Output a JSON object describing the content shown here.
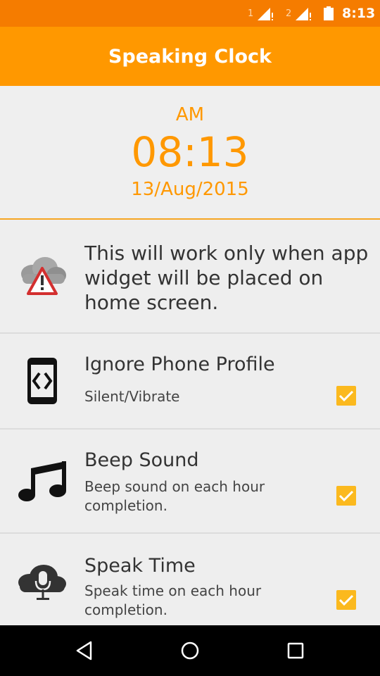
{
  "status_bar": {
    "sim1": "1",
    "sim2": "2",
    "time": "8:13"
  },
  "app_bar": {
    "title": "Speaking Clock"
  },
  "clock": {
    "ampm": "AM",
    "time": "08:13",
    "date": "13/Aug/2015"
  },
  "info": {
    "text": "This will work only when app widget will be placed on home screen.",
    "icon": "cloud-warning-icon"
  },
  "settings": [
    {
      "title": "Ignore Phone Profile",
      "subtitle": "Silent/Vibrate",
      "checked": true,
      "icon": "phone-code-icon"
    },
    {
      "title": "Beep Sound",
      "subtitle": "Beep sound on each hour completion.",
      "checked": true,
      "icon": "music-note-icon"
    },
    {
      "title": "Speak Time",
      "subtitle": "Speak time on each hour completion.",
      "checked": true,
      "icon": "cloud-microphone-icon"
    }
  ],
  "colors": {
    "accent": "#ff9800",
    "status_bar": "#f57c00",
    "checkbox": "#fbb91e"
  }
}
